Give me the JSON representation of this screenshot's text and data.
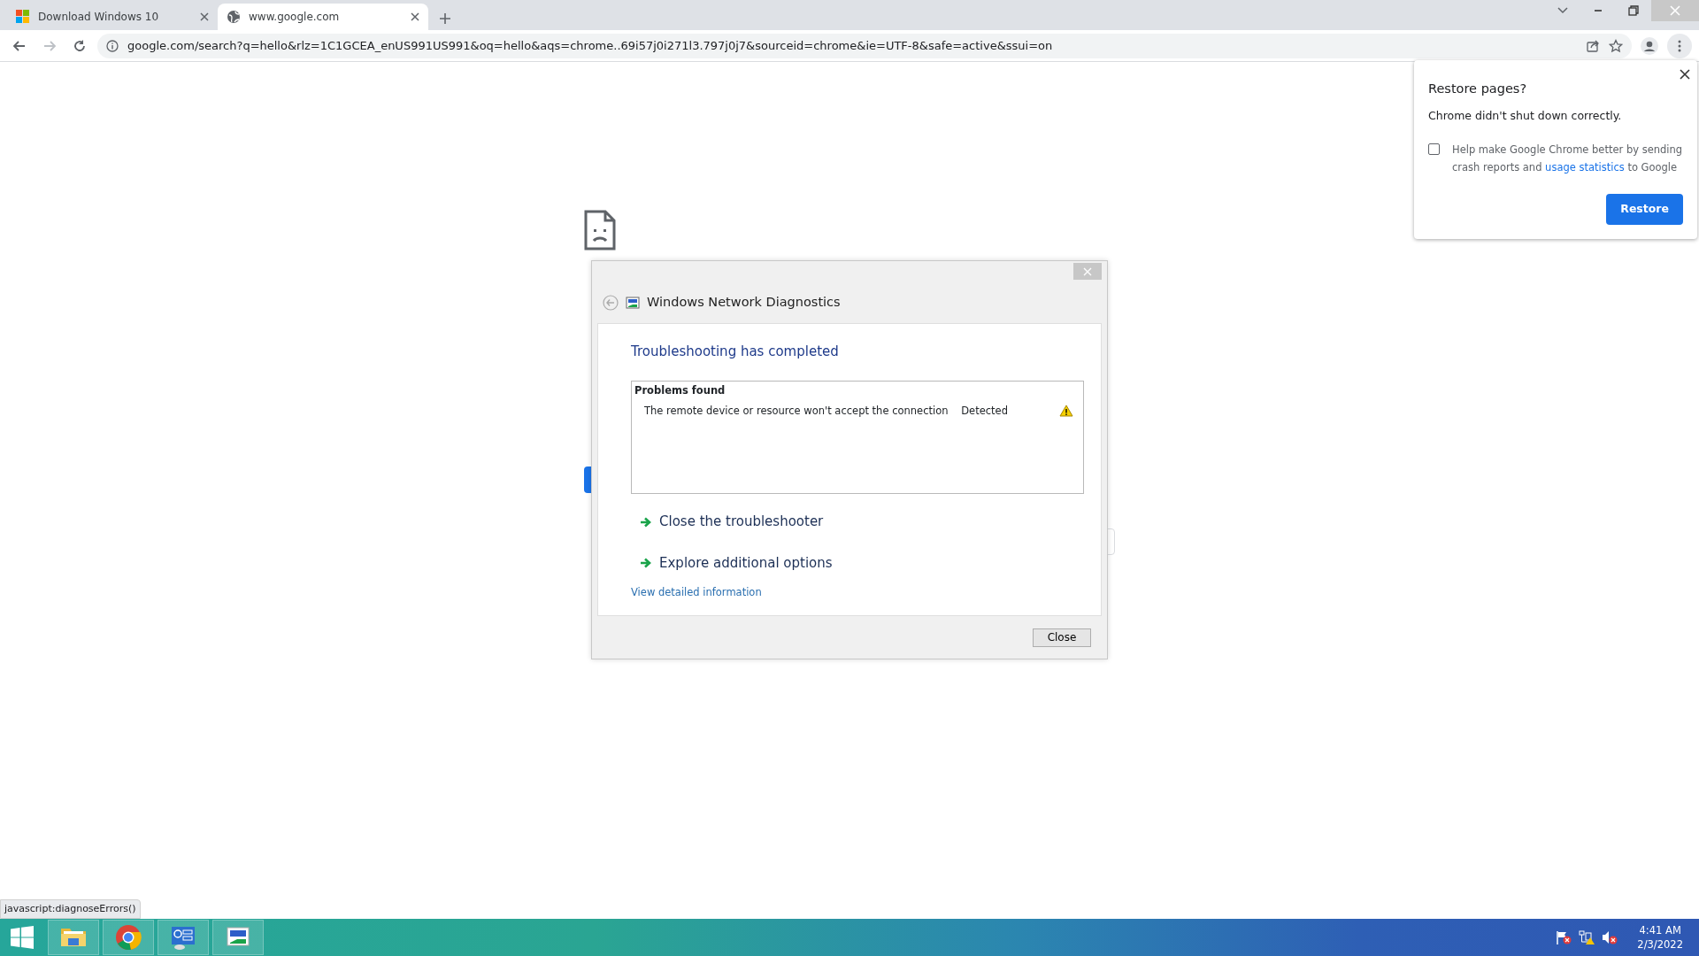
{
  "browser": {
    "tabs": [
      {
        "title": "Download Windows 10",
        "selected": false
      },
      {
        "title": "www.google.com",
        "selected": true
      }
    ],
    "address": "google.com/search?q=hello&rlz=1C1GCEA_enUS991US991&oq=hello&aqs=chrome..69i57j0i271l3.797j0j7&sourceid=chrome&ie=UTF-8&safe=active&ssui=on"
  },
  "dialog": {
    "title": "Windows Network Diagnostics",
    "heading": "Troubleshooting has completed",
    "problems_header": "Problems found",
    "problems": [
      {
        "text": "The remote device or resource won't accept the connection",
        "status": "Detected"
      }
    ],
    "options": [
      "Close the troubleshooter",
      "Explore additional options"
    ],
    "details_link": "View detailed information",
    "close_button": "Close"
  },
  "restore_popup": {
    "title": "Restore pages?",
    "message": "Chrome didn't shut down correctly.",
    "consent": {
      "checked": false,
      "before": "Help make Google Chrome better by sending crash reports and ",
      "link": "usage statistics",
      "after": " to Google"
    },
    "button": "Restore"
  },
  "status_bar": "javascript:diagnoseErrors()",
  "clock": {
    "time": "4:41 AM",
    "date": "2/3/2022"
  }
}
